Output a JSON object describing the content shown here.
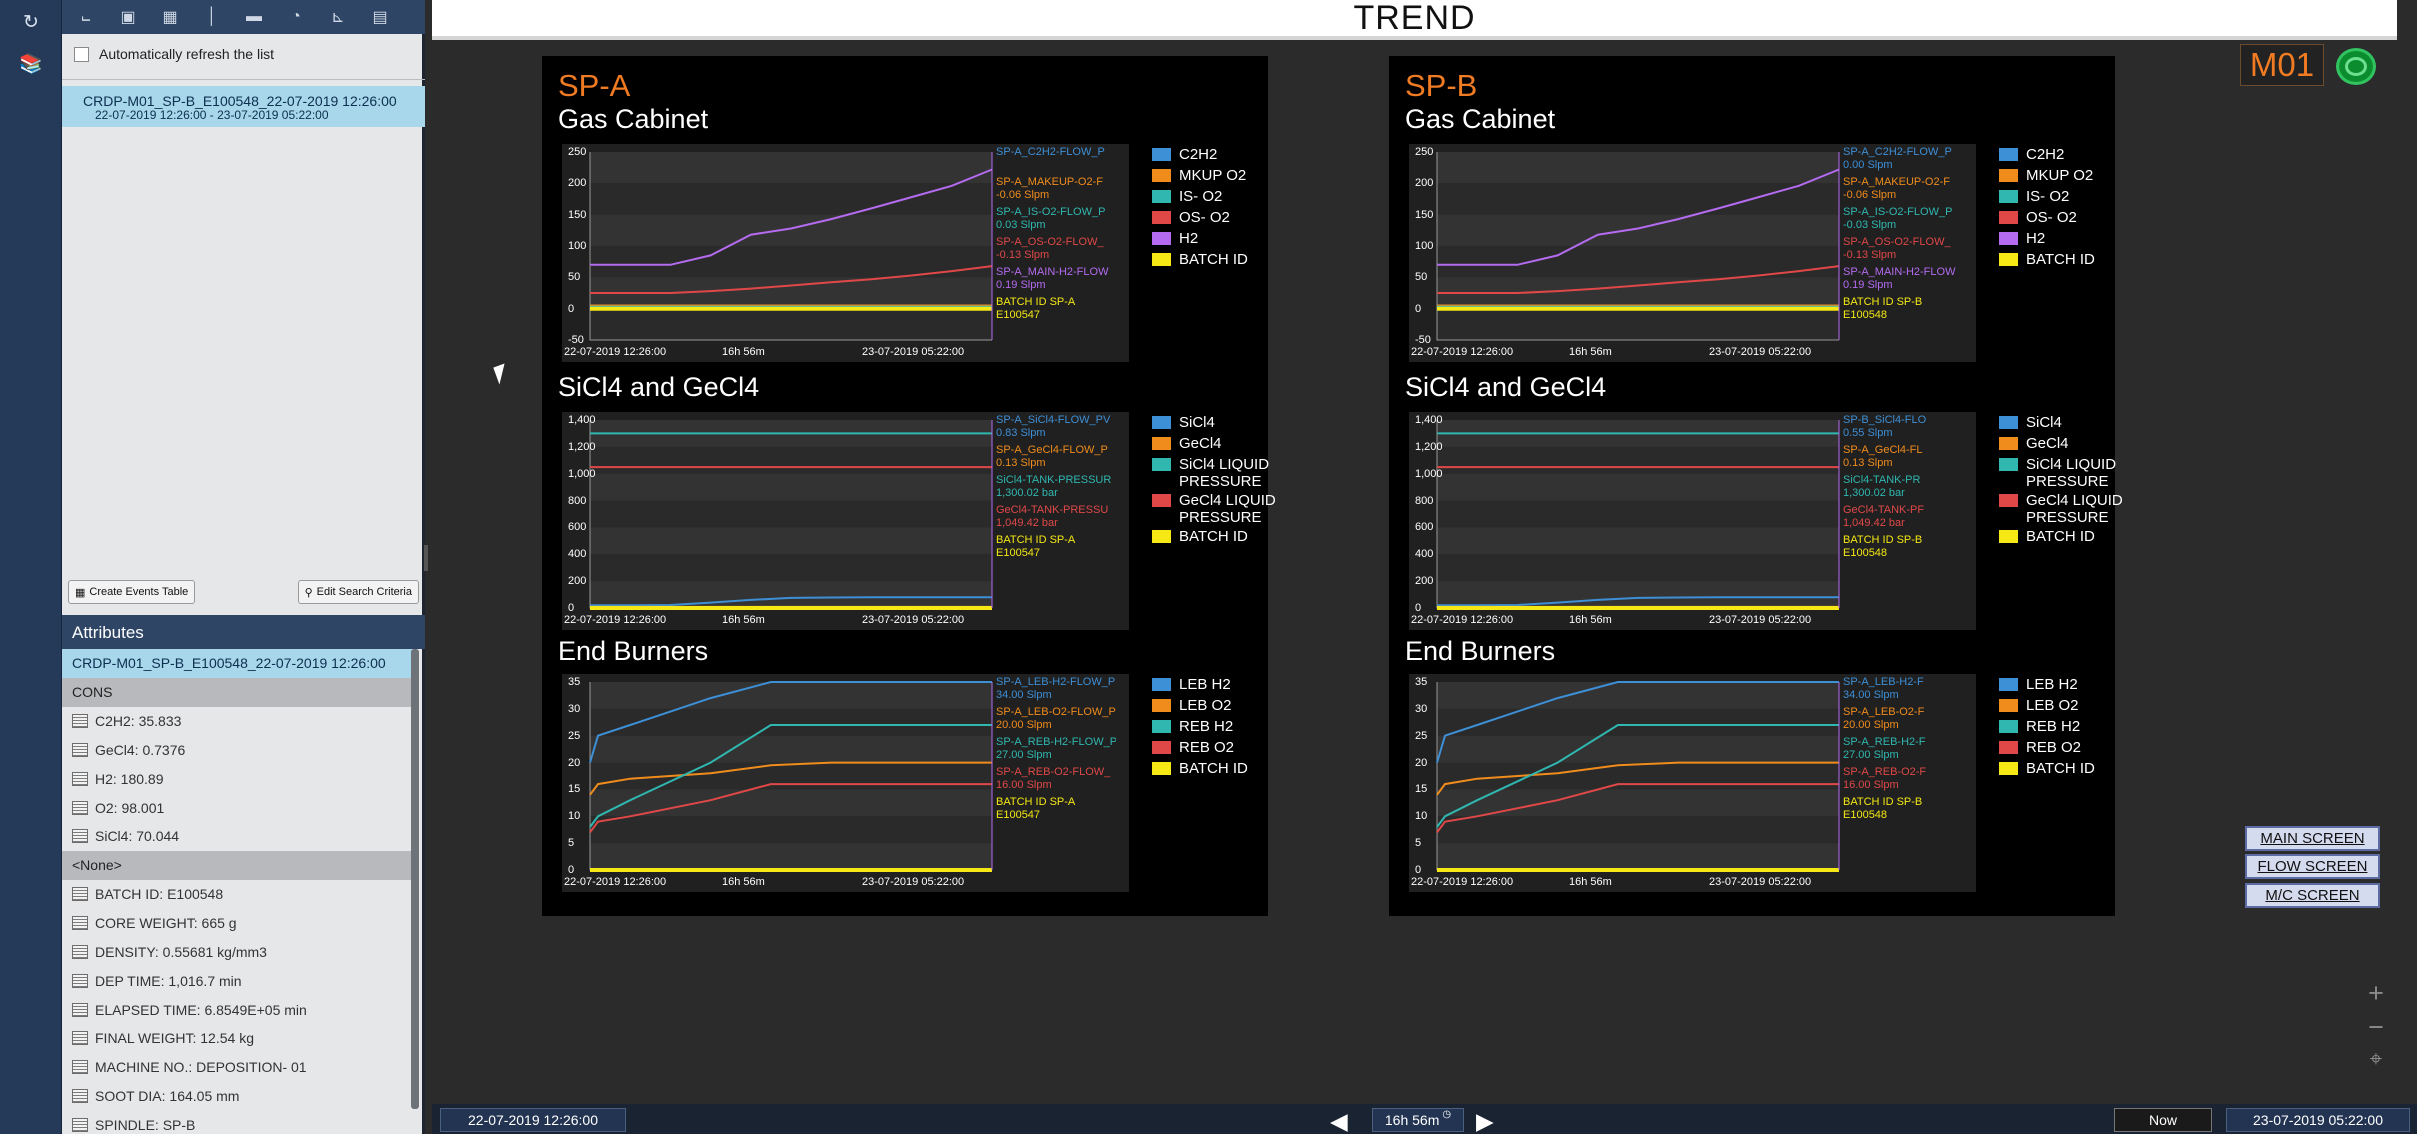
{
  "title": "TREND",
  "nav_icons": [
    "history-icon",
    "library-icon"
  ],
  "toolbar_icons": [
    "line-chart-icon",
    "number-icon",
    "table-icon",
    "thermometer-icon",
    "progress-bar-icon",
    "gauge-icon",
    "plot-icon",
    "calendar-icon"
  ],
  "left_panel": {
    "refresh_label": "Automatically refresh the list",
    "record_title": "CRDP-M01_SP-B_E100548_22-07-2019 12:26:00",
    "record_range": "22-07-2019 12:26:00 - 23-07-2019 05:22:00",
    "create_events_label": "Create Events Table",
    "edit_search_label": "Edit Search Criteria",
    "attributes_header": "Attributes",
    "attributes_selected": "CRDP-M01_SP-B_E100548_22-07-2019 12:26:00",
    "group_cons": "CONS",
    "cons_items": [
      "C2H2: 35.833",
      "GeCl4: 0.7376",
      "H2: 180.89",
      "O2: 98.001",
      "SiCl4: 70.044"
    ],
    "group_none": "<None>",
    "none_items": [
      "BATCH ID: E100548",
      "CORE WEIGHT: 665 g",
      "DENSITY: 0.55681 kg/mm3",
      "DEP TIME: 1,016.7 min",
      "ELAPSED TIME: 6.8549E+05 min",
      "FINAL WEIGHT: 12.54 kg",
      "MACHINE NO.: DEPOSITION- 01",
      "SOOT DIA: 164.05 mm",
      "SPINDLE: SP-B"
    ]
  },
  "machine_label": "M01",
  "status_color": "#2cc35a",
  "nav_buttons": [
    "MAIN SCREEN",
    "FLOW SCREEN",
    "M/C SCREEN"
  ],
  "zoom_icons": [
    "plus-icon",
    "minus-icon",
    "fit-icon"
  ],
  "time_bar": {
    "start": "22-07-2019 12:26:00",
    "duration": "16h 56m",
    "now_label": "Now",
    "end": "23-07-2019 05:22:00"
  },
  "colors": {
    "blue": "#3d8fd6",
    "orange": "#f08c1c",
    "teal": "#2fb7b0",
    "red": "#e04848",
    "purple": "#b46bf0",
    "yellow": "#f5e814",
    "accent": "#f07b22"
  },
  "panels": [
    {
      "name": "SP-A",
      "charts": [
        {
          "section": "Gas Cabinet",
          "legend": [
            "C2H2",
            "MKUP O2",
            "IS- O2",
            "OS- O2",
            "H2",
            "BATCH ID"
          ],
          "series_labels": [
            {
              "t1": "SP-A_C2H2-FLOW_P",
              "t2": ""
            },
            {
              "t1": "SP-A_MAKEUP-O2-F",
              "t2": "-0.06 Slpm"
            },
            {
              "t1": "SP-A_IS-O2-FLOW_P",
              "t2": "0.03 Slpm"
            },
            {
              "t1": "SP-A_OS-O2-FLOW_",
              "t2": "-0.13 Slpm"
            },
            {
              "t1": "SP-A_MAIN-H2-FLOW",
              "t2": "0.19 Slpm"
            },
            {
              "t1": "BATCH ID SP-A",
              "t2": "E100547"
            }
          ],
          "y_ticks": [
            "250",
            "200",
            "150",
            "100",
            "50",
            "0",
            "-50"
          ],
          "x_ticks": [
            "22-07-2019 12:26:00",
            "16h 56m",
            "23-07-2019 05:22:00"
          ]
        },
        {
          "section": "SiCl4 and GeCl4",
          "legend": [
            "SiCl4",
            "GeCl4",
            "SiCl4 LIQUID PRESSURE",
            "GeCl4 LIQUID PRESSURE",
            "BATCH ID"
          ],
          "series_labels": [
            {
              "t1": "SP-A_SiCl4-FLOW_PV",
              "t2": "0.83 Slpm"
            },
            {
              "t1": "SP-A_GeCl4-FLOW_P",
              "t2": "0.13 Slpm"
            },
            {
              "t1": "SiCl4-TANK-PRESSUR",
              "t2": "1,300.02 bar"
            },
            {
              "t1": "GeCl4-TANK-PRESSU",
              "t2": "1,049.42 bar"
            },
            {
              "t1": "BATCH ID SP-A",
              "t2": "E100547"
            }
          ],
          "y_ticks": [
            "1,400",
            "1,200",
            "1,000",
            "800",
            "600",
            "400",
            "200",
            "0"
          ],
          "x_ticks": [
            "22-07-2019 12:26:00",
            "16h 56m",
            "23-07-2019 05:22:00"
          ]
        },
        {
          "section": "End Burners",
          "legend": [
            "LEB H2",
            "LEB O2",
            "REB H2",
            "REB O2",
            "BATCH ID"
          ],
          "series_labels": [
            {
              "t1": "SP-A_LEB-H2-FLOW_P",
              "t2": "34.00 Slpm"
            },
            {
              "t1": "SP-A_LEB-O2-FLOW_P",
              "t2": "20.00 Slpm"
            },
            {
              "t1": "SP-A_REB-H2-FLOW_P",
              "t2": "27.00 Slpm"
            },
            {
              "t1": "SP-A_REB-O2-FLOW_",
              "t2": "16.00 Slpm"
            },
            {
              "t1": "BATCH ID SP-A",
              "t2": "E100547"
            }
          ],
          "y_ticks": [
            "35",
            "30",
            "25",
            "20",
            "15",
            "10",
            "5",
            "0"
          ],
          "x_ticks": [
            "22-07-2019 12:26:00",
            "16h 56m",
            "23-07-2019 05:22:00"
          ]
        }
      ]
    },
    {
      "name": "SP-B",
      "charts": [
        {
          "section": "Gas Cabinet",
          "legend": [
            "C2H2",
            "MKUP O2",
            "IS- O2",
            "OS- O2",
            "H2",
            "BATCH ID"
          ],
          "series_labels": [
            {
              "t1": "SP-A_C2H2-FLOW_P",
              "t2": "0.00 Slpm"
            },
            {
              "t1": "SP-A_MAKEUP-O2-F",
              "t2": "-0.06 Slpm"
            },
            {
              "t1": "SP-A_IS-O2-FLOW_P",
              "t2": "-0.03 Slpm"
            },
            {
              "t1": "SP-A_OS-O2-FLOW_",
              "t2": "-0.13 Slpm"
            },
            {
              "t1": "SP-A_MAIN-H2-FLOW",
              "t2": "0.19 Slpm"
            },
            {
              "t1": "BATCH ID SP-B",
              "t2": "E100548"
            }
          ],
          "y_ticks": [
            "250",
            "200",
            "150",
            "100",
            "50",
            "0",
            "-50"
          ],
          "x_ticks": [
            "22-07-2019 12:26:00",
            "16h 56m",
            "23-07-2019 05:22:00"
          ]
        },
        {
          "section": "SiCl4 and GeCl4",
          "legend": [
            "SiCl4",
            "GeCl4",
            "SiCl4 LIQUID PRESSURE",
            "GeCl4 LIQUID PRESSURE",
            "BATCH ID"
          ],
          "series_labels": [
            {
              "t1": "SP-B_SiCl4-FLO",
              "t2": "0.55 Slpm"
            },
            {
              "t1": "SP-A_GeCl4-FL",
              "t2": "0.13 Slpm"
            },
            {
              "t1": "SiCl4-TANK-PR",
              "t2": "1,300.02 bar"
            },
            {
              "t1": "GeCl4-TANK-PF",
              "t2": "1,049.42 bar"
            },
            {
              "t1": "BATCH ID SP-B",
              "t2": "E100548"
            }
          ],
          "y_ticks": [
            "1,400",
            "1,200",
            "1,000",
            "800",
            "600",
            "400",
            "200",
            "0"
          ],
          "x_ticks": [
            "22-07-2019 12:26:00",
            "16h 56m",
            "23-07-2019 05:22:00"
          ]
        },
        {
          "section": "End Burners",
          "legend": [
            "LEB H2",
            "LEB O2",
            "REB H2",
            "REB O2",
            "BATCH ID"
          ],
          "series_labels": [
            {
              "t1": "SP-A_LEB-H2-F",
              "t2": "34.00 Slpm"
            },
            {
              "t1": "SP-A_LEB-O2-F",
              "t2": "20.00 Slpm"
            },
            {
              "t1": "SP-A_REB-H2-F",
              "t2": "27.00 Slpm"
            },
            {
              "t1": "SP-A_REB-O2-F",
              "t2": "16.00 Slpm"
            },
            {
              "t1": "BATCH ID SP-B",
              "t2": "E100548"
            }
          ],
          "y_ticks": [
            "35",
            "30",
            "25",
            "20",
            "15",
            "10",
            "5",
            "0"
          ],
          "x_ticks": [
            "22-07-2019 12:26:00",
            "16h 56m",
            "23-07-2019 05:22:00"
          ]
        }
      ]
    }
  ],
  "chart_data": [
    {
      "type": "line",
      "panel": "SP-A",
      "title": "Gas Cabinet",
      "x": [
        0,
        0.1,
        0.2,
        0.3,
        0.4,
        0.5,
        0.6,
        0.7,
        0.8,
        0.9,
        1.0
      ],
      "ylim": [
        -50,
        250
      ],
      "series": [
        {
          "name": "C2H2",
          "color": "#3d8fd6",
          "values": [
            2,
            2,
            2,
            2,
            2,
            2,
            2,
            2,
            2,
            2,
            2
          ]
        },
        {
          "name": "MKUP O2",
          "color": "#f08c1c",
          "values": [
            5,
            5,
            5,
            5,
            5,
            5,
            5,
            5,
            5,
            5,
            5
          ]
        },
        {
          "name": "IS- O2",
          "color": "#2fb7b0",
          "values": [
            3,
            3,
            3,
            3,
            3,
            3,
            3,
            3,
            3,
            3,
            3
          ]
        },
        {
          "name": "OS- O2",
          "color": "#e04848",
          "values": [
            25,
            25,
            25,
            28,
            32,
            37,
            42,
            47,
            53,
            60,
            68
          ]
        },
        {
          "name": "H2",
          "color": "#b46bf0",
          "values": [
            70,
            70,
            70,
            85,
            118,
            128,
            143,
            160,
            178,
            196,
            222
          ]
        },
        {
          "name": "BATCH ID",
          "color": "#f5e814",
          "values": [
            0,
            0,
            0,
            0,
            0,
            0,
            0,
            0,
            0,
            0,
            0
          ]
        }
      ]
    },
    {
      "type": "line",
      "panel": "SP-A",
      "title": "SiCl4 and GeCl4",
      "x": [
        0,
        0.1,
        0.2,
        0.3,
        0.4,
        0.5,
        0.6,
        0.7,
        0.8,
        0.9,
        1.0
      ],
      "ylim": [
        0,
        1400
      ],
      "series": [
        {
          "name": "SiCl4",
          "color": "#3d8fd6",
          "values": [
            20,
            20,
            22,
            40,
            60,
            75,
            78,
            80,
            80,
            80,
            80
          ]
        },
        {
          "name": "GeCl4",
          "color": "#f08c1c",
          "values": [
            8,
            8,
            8,
            8,
            8,
            8,
            8,
            8,
            8,
            8,
            8
          ]
        },
        {
          "name": "SiCl4 LIQUID PRESSURE",
          "color": "#2fb7b0",
          "values": [
            1300,
            1300,
            1300,
            1300,
            1300,
            1300,
            1300,
            1300,
            1300,
            1300,
            1300
          ]
        },
        {
          "name": "GeCl4 LIQUID PRESSURE",
          "color": "#e04848",
          "values": [
            1049,
            1049,
            1049,
            1049,
            1049,
            1049,
            1049,
            1049,
            1049,
            1049,
            1049
          ]
        },
        {
          "name": "BATCH ID",
          "color": "#f5e814",
          "values": [
            0,
            0,
            0,
            0,
            0,
            0,
            0,
            0,
            0,
            0,
            0
          ]
        }
      ]
    },
    {
      "type": "line",
      "panel": "SP-A",
      "title": "End Burners",
      "x": [
        0,
        0.02,
        0.1,
        0.3,
        0.45,
        0.6,
        0.8,
        1.0
      ],
      "ylim": [
        0,
        35
      ],
      "series": [
        {
          "name": "LEB H2",
          "color": "#3d8fd6",
          "values": [
            20,
            25,
            27,
            32,
            35,
            35,
            35,
            35
          ]
        },
        {
          "name": "LEB O2",
          "color": "#f08c1c",
          "values": [
            14,
            16,
            17,
            18,
            19.5,
            20,
            20,
            20
          ]
        },
        {
          "name": "REB H2",
          "color": "#2fb7b0",
          "values": [
            8,
            10,
            13,
            20,
            27,
            27,
            27,
            27
          ]
        },
        {
          "name": "REB O2",
          "color": "#e04848",
          "values": [
            7,
            9,
            10,
            13,
            16,
            16,
            16,
            16
          ]
        },
        {
          "name": "BATCH ID",
          "color": "#f5e814",
          "values": [
            0,
            0,
            0,
            0,
            0,
            0,
            0,
            0
          ]
        }
      ]
    },
    {
      "type": "line",
      "panel": "SP-B",
      "title": "Gas Cabinet",
      "x": [
        0,
        0.1,
        0.2,
        0.3,
        0.4,
        0.5,
        0.6,
        0.7,
        0.8,
        0.9,
        1.0
      ],
      "ylim": [
        -50,
        250
      ],
      "series": [
        {
          "name": "C2H2",
          "color": "#3d8fd6",
          "values": [
            2,
            2,
            2,
            2,
            2,
            2,
            2,
            2,
            2,
            2,
            2
          ]
        },
        {
          "name": "MKUP O2",
          "color": "#f08c1c",
          "values": [
            5,
            5,
            5,
            5,
            5,
            5,
            5,
            5,
            5,
            5,
            5
          ]
        },
        {
          "name": "IS- O2",
          "color": "#2fb7b0",
          "values": [
            3,
            3,
            3,
            3,
            3,
            3,
            3,
            3,
            3,
            3,
            3
          ]
        },
        {
          "name": "OS- O2",
          "color": "#e04848",
          "values": [
            25,
            25,
            25,
            28,
            32,
            37,
            42,
            47,
            53,
            60,
            68
          ]
        },
        {
          "name": "H2",
          "color": "#b46bf0",
          "values": [
            70,
            70,
            70,
            85,
            118,
            128,
            143,
            160,
            178,
            196,
            222
          ]
        },
        {
          "name": "BATCH ID",
          "color": "#f5e814",
          "values": [
            0,
            0,
            0,
            0,
            0,
            0,
            0,
            0,
            0,
            0,
            0
          ]
        }
      ]
    },
    {
      "type": "line",
      "panel": "SP-B",
      "title": "SiCl4 and GeCl4",
      "x": [
        0,
        0.1,
        0.2,
        0.3,
        0.4,
        0.5,
        0.6,
        0.7,
        0.8,
        0.9,
        1.0
      ],
      "ylim": [
        0,
        1400
      ],
      "series": [
        {
          "name": "SiCl4",
          "color": "#3d8fd6",
          "values": [
            20,
            20,
            22,
            40,
            60,
            75,
            78,
            80,
            80,
            80,
            80
          ]
        },
        {
          "name": "GeCl4",
          "color": "#f08c1c",
          "values": [
            8,
            8,
            8,
            8,
            8,
            8,
            8,
            8,
            8,
            8,
            8
          ]
        },
        {
          "name": "SiCl4 LIQUID PRESSURE",
          "color": "#2fb7b0",
          "values": [
            1300,
            1300,
            1300,
            1300,
            1300,
            1300,
            1300,
            1300,
            1300,
            1300,
            1300
          ]
        },
        {
          "name": "GeCl4 LIQUID PRESSURE",
          "color": "#e04848",
          "values": [
            1049,
            1049,
            1049,
            1049,
            1049,
            1049,
            1049,
            1049,
            1049,
            1049,
            1049
          ]
        },
        {
          "name": "BATCH ID",
          "color": "#f5e814",
          "values": [
            0,
            0,
            0,
            0,
            0,
            0,
            0,
            0,
            0,
            0,
            0
          ]
        }
      ]
    },
    {
      "type": "line",
      "panel": "SP-B",
      "title": "End Burners",
      "x": [
        0,
        0.02,
        0.1,
        0.3,
        0.45,
        0.6,
        0.8,
        1.0
      ],
      "ylim": [
        0,
        35
      ],
      "series": [
        {
          "name": "LEB H2",
          "color": "#3d8fd6",
          "values": [
            20,
            25,
            27,
            32,
            35,
            35,
            35,
            35
          ]
        },
        {
          "name": "LEB O2",
          "color": "#f08c1c",
          "values": [
            14,
            16,
            17,
            18,
            19.5,
            20,
            20,
            20
          ]
        },
        {
          "name": "REB H2",
          "color": "#2fb7b0",
          "values": [
            8,
            10,
            13,
            20,
            27,
            27,
            27,
            27
          ]
        },
        {
          "name": "REB O2",
          "color": "#e04848",
          "values": [
            7,
            9,
            10,
            13,
            16,
            16,
            16,
            16
          ]
        },
        {
          "name": "BATCH ID",
          "color": "#f5e814",
          "values": [
            0,
            0,
            0,
            0,
            0,
            0,
            0,
            0
          ]
        }
      ]
    }
  ]
}
